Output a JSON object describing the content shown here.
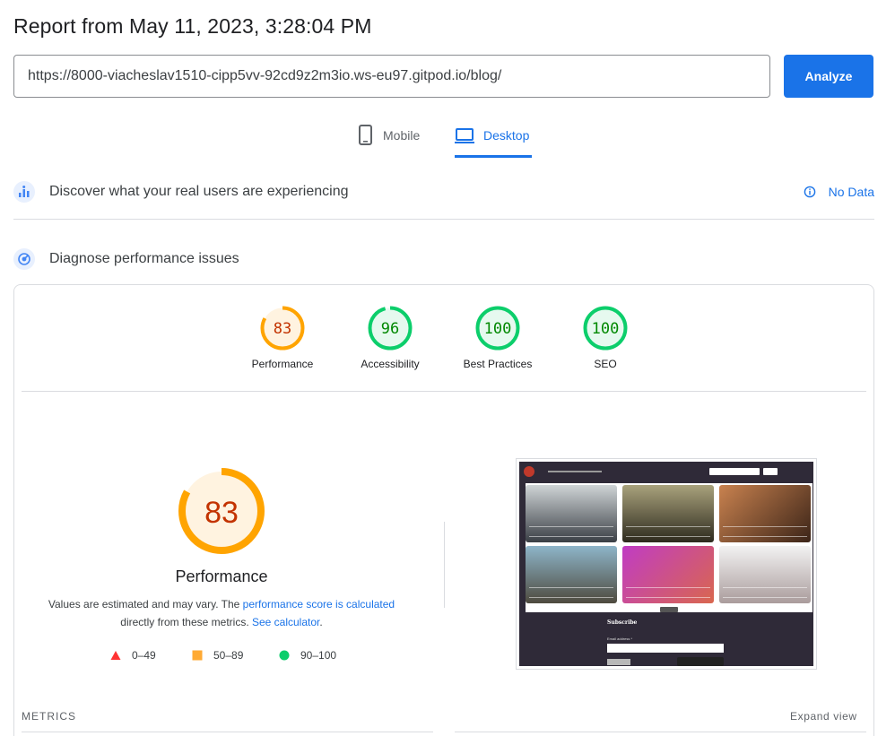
{
  "header": {
    "title": "Report from May 11, 2023, 3:28:04 PM"
  },
  "url_bar": {
    "value": "https://8000-viacheslav1510-cipp5vv-92cd9z2m3io.ws-eu97.gitpod.io/blog/",
    "analyze_label": "Analyze"
  },
  "device_tabs": {
    "mobile": "Mobile",
    "desktop": "Desktop",
    "selected": "desktop"
  },
  "field_data": {
    "heading": "Discover what your real users are experiencing",
    "status": "No Data"
  },
  "diagnose": {
    "heading": "Diagnose performance issues"
  },
  "categories": [
    {
      "label": "Performance",
      "score": "83",
      "status": "average"
    },
    {
      "label": "Accessibility",
      "score": "96",
      "status": "pass"
    },
    {
      "label": "Best Practices",
      "score": "100",
      "status": "pass"
    },
    {
      "label": "SEO",
      "score": "100",
      "status": "pass"
    }
  ],
  "performance_detail": {
    "score": "83",
    "title": "Performance",
    "note_prefix": "Values are estimated and may vary. The ",
    "note_link": "performance score is calculated",
    "note_mid": "directly from these metrics. ",
    "note_link2": "See calculator",
    "note_suffix": "."
  },
  "legend": [
    {
      "range": "0–49",
      "color": "#ff3333"
    },
    {
      "range": "50–89",
      "color": "#ffaa33"
    },
    {
      "range": "90–100",
      "color": "#0cce6b"
    }
  ],
  "screenshot": {
    "subscribe": "Subscribe",
    "email_label": "Email address *"
  },
  "metrics": {
    "heading": "METRICS",
    "expand_label": "Expand view"
  },
  "colors": {
    "accent": "#1a73e8",
    "average": "#ffa400",
    "pass": "#0cce6b",
    "average_text": "#c33300",
    "pass_text": "#008800"
  }
}
